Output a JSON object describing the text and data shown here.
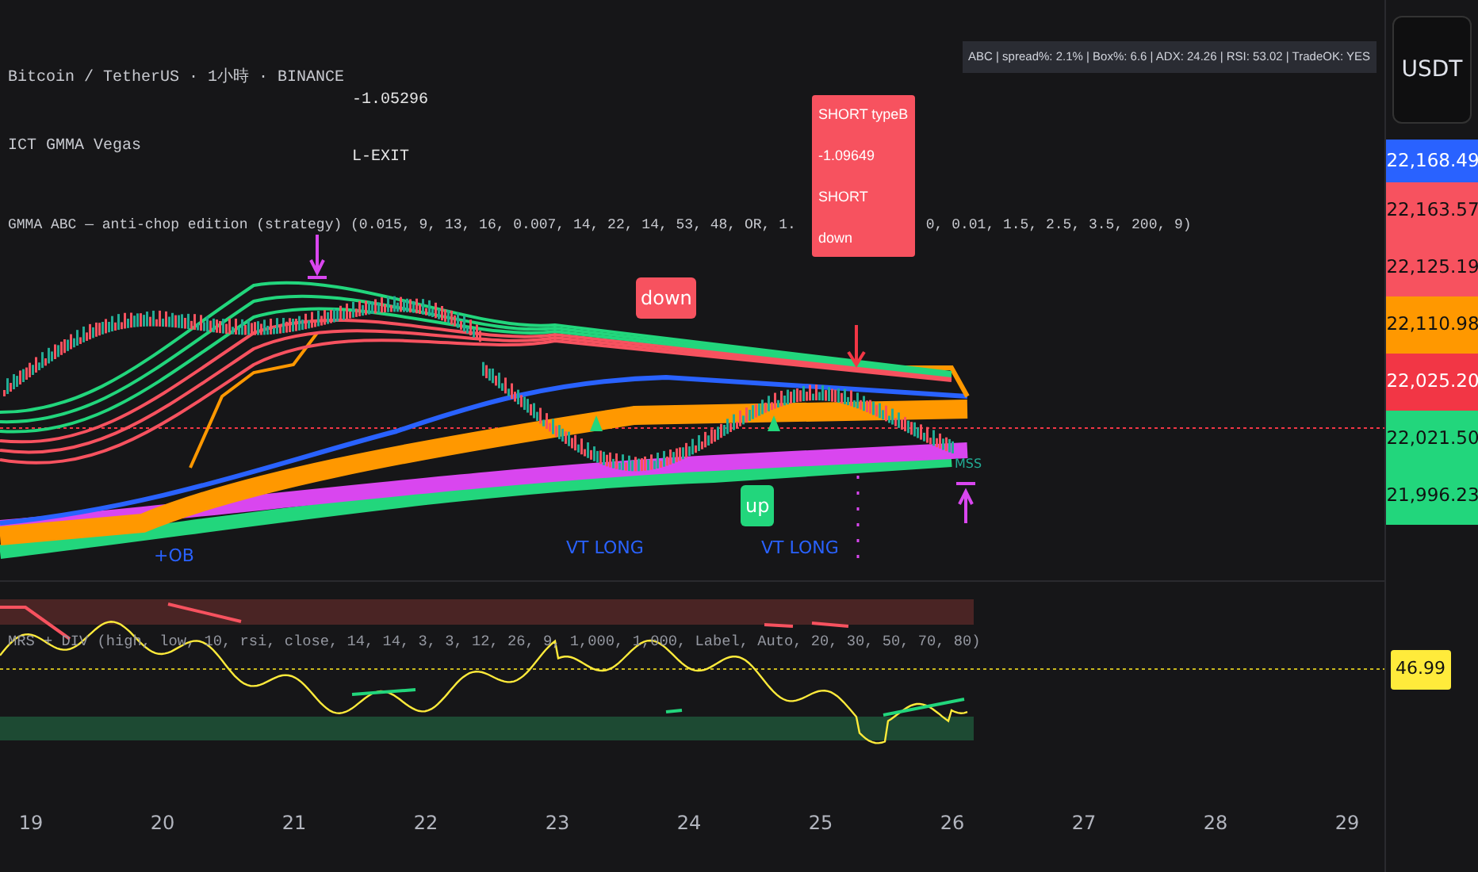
{
  "legend": [
    {
      "text": "Bitcoin / TetherUS · 1小時 · BINANCE"
    },
    {
      "text": "ICT GMMA Vegas"
    }
  ],
  "strategy_legend": {
    "text_before_box": "GMMA ABC — anti-chop edition (strategy) (0.015, 9, 13, 16, 0.007, 14, 22, 14, 53, 48, OR, 1.",
    "text_after_box": "0, 0.01, 1.5, 2.5, 3.5, 200, 9)"
  },
  "info_panel": {
    "text": "ABC | spread%: 2.1% | Box%: 6.6 | ADX: 24.26 | RSI: 53.02 | TradeOK: YES"
  },
  "currency_button": {
    "label": "USDT"
  },
  "exit_labels": [
    "-1.05296",
    "L-EXIT"
  ],
  "signal_box": {
    "lines": [
      "SHORT typeB",
      "-1.09649",
      "SHORT",
      "down"
    ]
  },
  "chart_labels": [
    {
      "kind": "bubble",
      "text": "down",
      "color": "#f7525f"
    },
    {
      "kind": "bubble",
      "text": "up",
      "color": "#22d67c"
    },
    {
      "kind": "plain",
      "text": "+OB"
    },
    {
      "kind": "plain",
      "text": "VT LONG"
    },
    {
      "kind": "plain",
      "text": "VT LONG"
    },
    {
      "kind": "plain",
      "text": "MSS"
    }
  ],
  "price_labels": [
    {
      "text": "22,168.49",
      "color": "#2962ff"
    },
    {
      "text": "22,163.57",
      "color": "#f7525f"
    },
    {
      "text": "22,125.19",
      "color": "#f7525f"
    },
    {
      "text": "22,110.98",
      "color": "#ff9800"
    },
    {
      "text": "22,025.20",
      "color": "#f23645"
    },
    {
      "text": "22,021.50",
      "color": "#22d67c"
    },
    {
      "text": "21,996.23",
      "color": "#22d67c"
    }
  ],
  "oscillator": {
    "legend": "MRS + DIV (high, low, 10, rsi, close, 14, 14, 3, 3, 12, 26, 9, 1,000, 1,000, Label, Auto, 20, 30, 50, 70, 80)",
    "value_label": "46.99"
  },
  "date_axis": [
    "19",
    "20",
    "21",
    "22",
    "23",
    "24",
    "25",
    "26",
    "27",
    "28",
    "29"
  ]
}
